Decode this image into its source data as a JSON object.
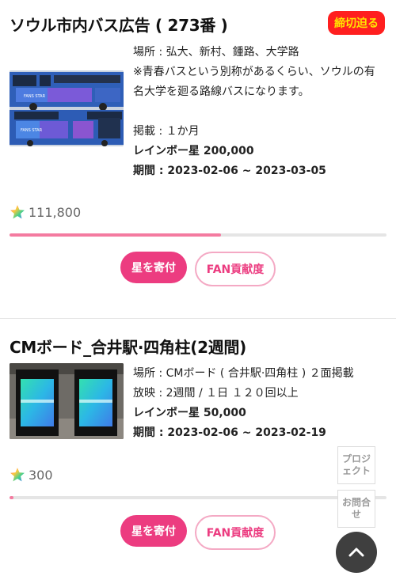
{
  "ads": [
    {
      "title": "ソウル市内バス広告 ( 273番 )",
      "badge": "締切迫る",
      "info": {
        "location": "場所 : 弘大、新村、鍾路、大学路",
        "note": "※青春バスという別称があるくらい、ソウルの有名大学を廻る路線バスになります。",
        "duration": "掲載 : １か月",
        "price": "レインボー星 200,000",
        "period": "期間 : 2023-02-06 ~ 2023-03-05"
      },
      "star_count": "111,800",
      "progress": 0.56,
      "donate_label": "星を寄付",
      "fan_label": "FAN貢献度",
      "image_text": "FANS STAR"
    },
    {
      "title": "CMボード_合井駅·四角柱(2週間)",
      "info": {
        "location": "場所 : CMボード ( 合井駅·四角柱 ) ２面掲載",
        "duration": "放映 : 2週間 / １日 １２０回以上",
        "price": "レインボー星 50,000",
        "period": "期間 : 2023-02-06 ~ 2023-02-19"
      },
      "star_count": "300",
      "progress": 0.01,
      "donate_label": "星を寄付",
      "fan_label": "FAN貢献度"
    }
  ],
  "side_buttons": {
    "project": "プロジェクト",
    "inquiry": "お問合せ"
  },
  "colors": {
    "accent": "#ec3c80",
    "progress": "#f47ba0",
    "badge_bg": "#ff1f1f",
    "badge_text": "#ffe600"
  },
  "icons": {
    "star": "rainbow-star-icon",
    "scroll_top": "chevron-up-icon"
  }
}
